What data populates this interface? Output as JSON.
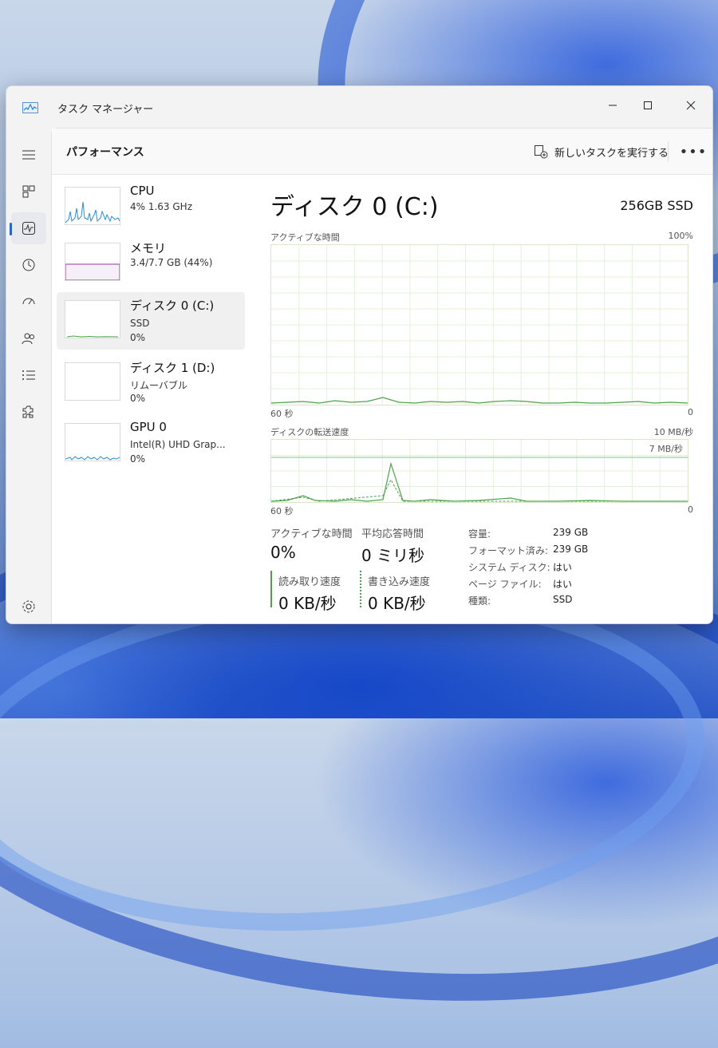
{
  "window": {
    "title": "タスク マネージャー"
  },
  "header": {
    "title": "パフォーマンス",
    "run_task": "新しいタスクを実行する"
  },
  "nav": [
    "menu",
    "processes",
    "performance",
    "app-history",
    "startup",
    "users",
    "details",
    "services",
    "settings"
  ],
  "perf_list": [
    {
      "name": "CPU",
      "line1": "4%  1.63 GHz",
      "line2": "",
      "color": "#2a8dd4"
    },
    {
      "name": "メモリ",
      "line1": "3.4/7.7 GB (44%)",
      "line2": "",
      "color": "#8a3f9e"
    },
    {
      "name": "ディスク 0 (C:)",
      "line1": "SSD",
      "line2": "0%",
      "color": "#4da24d"
    },
    {
      "name": "ディスク 1 (D:)",
      "line1": "リムーバブル",
      "line2": "0%",
      "color": "#4da24d"
    },
    {
      "name": "GPU 0",
      "line1": "Intel(R) UHD Grap...",
      "line2": "0%",
      "color": "#2a8dd4"
    }
  ],
  "detail": {
    "title": "ディスク 0 (C:)",
    "model": "256GB SSD",
    "graph1": {
      "label": "アクティブな時間",
      "max": "100%",
      "xlabel": "60 秒",
      "min": "0"
    },
    "graph2": {
      "label": "ディスクの転送速度",
      "max": "10 MB/秒",
      "ref": "7 MB/秒",
      "xlabel": "60 秒",
      "min": "0"
    },
    "stats": {
      "active_label": "アクティブな時間",
      "active_value": "0%",
      "resp_label": "平均応答時間",
      "resp_value": "0 ミリ秒",
      "read_label": "読み取り速度",
      "read_value": "0 KB/秒",
      "write_label": "書き込み速度",
      "write_value": "0 KB/秒"
    },
    "info": [
      {
        "k": "容量:",
        "v": "239 GB"
      },
      {
        "k": "フォーマット済み:",
        "v": "239 GB"
      },
      {
        "k": "システム ディスク:",
        "v": "はい"
      },
      {
        "k": "ページ ファイル:",
        "v": "はい"
      },
      {
        "k": "種類:",
        "v": "SSD"
      }
    ]
  },
  "colors": {
    "accent": "#2b66c3",
    "disk": "#4da24d",
    "cpu": "#2a8dd4",
    "memory": "#8a3f9e"
  }
}
